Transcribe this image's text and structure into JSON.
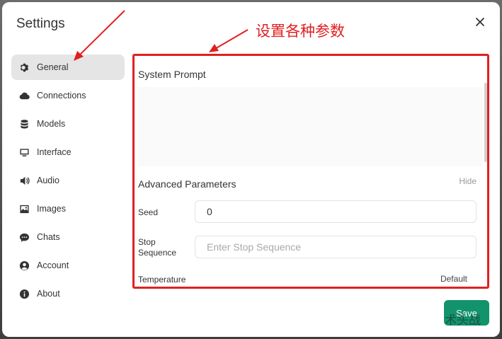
{
  "modal": {
    "title": "Settings"
  },
  "sidebar": {
    "items": [
      {
        "label": "General",
        "icon": "gear-icon",
        "active": true
      },
      {
        "label": "Connections",
        "icon": "cloud-icon"
      },
      {
        "label": "Models",
        "icon": "database-icon"
      },
      {
        "label": "Interface",
        "icon": "monitor-icon"
      },
      {
        "label": "Audio",
        "icon": "speaker-icon"
      },
      {
        "label": "Images",
        "icon": "image-icon"
      },
      {
        "label": "Chats",
        "icon": "chat-bubble-icon"
      },
      {
        "label": "Account",
        "icon": "user-circle-icon"
      },
      {
        "label": "About",
        "icon": "info-icon"
      }
    ]
  },
  "general": {
    "system_prompt_label": "System Prompt",
    "system_prompt_value": "",
    "advanced_label": "Advanced Parameters",
    "hide_label": "Hide",
    "seed_label": "Seed",
    "seed_value": "0",
    "stop_label": "Stop Sequence",
    "stop_placeholder": "Enter Stop Sequence",
    "stop_value": "",
    "temperature_label": "Temperature",
    "temperature_value": "Default"
  },
  "footer": {
    "save_label": "Save",
    "watermark": "术头战"
  },
  "annotation": {
    "text": "设置各种参数",
    "color": "#e02020"
  },
  "colors": {
    "accent": "#12936b",
    "active_nav": "#e5e5e5",
    "annotation_red": "#e02020"
  }
}
